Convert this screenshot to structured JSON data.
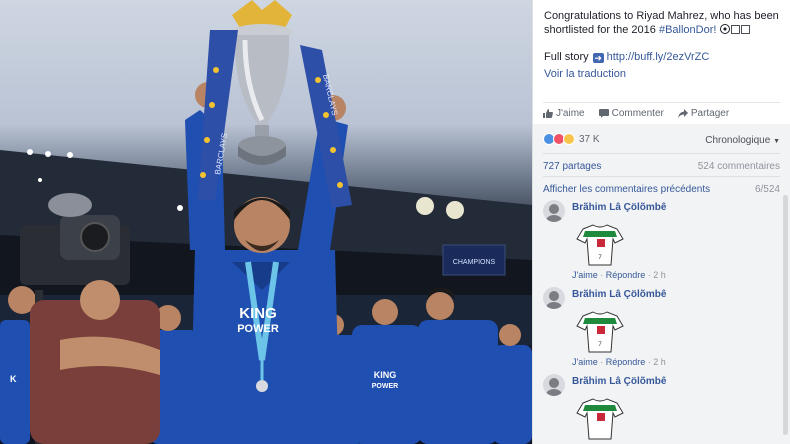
{
  "post": {
    "text_before": "Congratulations to Riyad Mahrez, who has been shortlisted for the 2016 ",
    "hashtag": "#BallonDor!",
    "full_story_label": "Full story",
    "link": "http://buff.ly/2ezVrZC",
    "translate": "Voir la traduction"
  },
  "actions": {
    "like": "J'aime",
    "comment": "Commenter",
    "share": "Partager"
  },
  "stats": {
    "reactions_count": "37 K",
    "sort": "Chronologique",
    "shares": "727 partages",
    "comments": "524 commentaires",
    "previous": "Afficher les commentaires précédents",
    "pager": "6/524"
  },
  "comments": [
    {
      "author": "Brãhim Lâ Çölõmbê",
      "like": "J'aime",
      "reply": "Répondre",
      "time": "2 h"
    },
    {
      "author": "Brãhim Lâ Çölõmbê",
      "like": "J'aime",
      "reply": "Répondre",
      "time": "2 h"
    },
    {
      "author": "Brãhim Lâ Çölõmbê"
    }
  ],
  "photo": {
    "shirt_text_1": "KING",
    "shirt_text_2": "POWER",
    "ribbon_text": "BARCLAYS",
    "screen_text": "CHAMPIONS"
  },
  "colors": {
    "link": "#365899",
    "kit_blue": "#1f4fb0",
    "panel_bg": "#ffffff"
  }
}
